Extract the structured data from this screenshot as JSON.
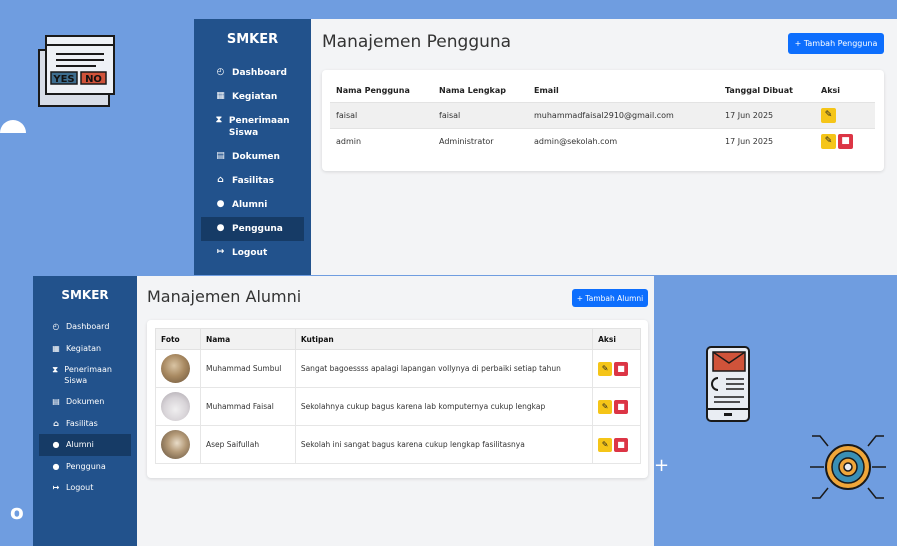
{
  "window1": {
    "brand": "SMKER",
    "nav": [
      {
        "icon": "◴",
        "label": "Dashboard"
      },
      {
        "icon": "▦",
        "label": "Kegiatan"
      },
      {
        "icon": "⧗",
        "label": "Penerimaan Siswa"
      },
      {
        "icon": "▤",
        "label": "Dokumen"
      },
      {
        "icon": "⌂",
        "label": "Fasilitas"
      },
      {
        "icon": "●",
        "label": "Alumni"
      },
      {
        "icon": "●",
        "label": "Pengguna"
      },
      {
        "icon": "↦",
        "label": "Logout"
      }
    ],
    "active_nav": "Pengguna",
    "title": "Manajemen Pengguna",
    "add_button": "+ Tambah Pengguna",
    "columns": [
      "Nama Pengguna",
      "Nama Lengkap",
      "Email",
      "Tanggal Dibuat",
      "Aksi"
    ],
    "rows": [
      {
        "username": "faisal",
        "fullname": "faisal",
        "email": "muhammadfaisal2910@gmail.com",
        "created": "17 Jun 2025",
        "can_delete": false
      },
      {
        "username": "admin",
        "fullname": "Administrator",
        "email": "admin@sekolah.com",
        "created": "17 Jun 2025",
        "can_delete": true
      }
    ]
  },
  "window2": {
    "brand": "SMKER",
    "nav": [
      {
        "icon": "◴",
        "label": "Dashboard"
      },
      {
        "icon": "▦",
        "label": "Kegiatan"
      },
      {
        "icon": "⧗",
        "label": "Penerimaan Siswa"
      },
      {
        "icon": "▤",
        "label": "Dokumen"
      },
      {
        "icon": "⌂",
        "label": "Fasilitas"
      },
      {
        "icon": "●",
        "label": "Alumni"
      },
      {
        "icon": "●",
        "label": "Pengguna"
      },
      {
        "icon": "↦",
        "label": "Logout"
      }
    ],
    "active_nav": "Alumni",
    "title": "Manajemen Alumni",
    "add_button": "+ Tambah Alumni",
    "columns": [
      "Foto",
      "Nama",
      "Kutipan",
      "Aksi"
    ],
    "rows": [
      {
        "name": "Muhammad Sumbul",
        "quote": "Sangat bagoessss apalagi lapangan vollynya di perbaiki setiap tahun"
      },
      {
        "name": "Muhammad Faisal",
        "quote": "Sekolahnya cukup bagus karena lab komputernya cukup lengkap"
      },
      {
        "name": "Asep Saifullah",
        "quote": "Sekolah ini sangat bagus karena cukup lengkap fasilitasnya"
      }
    ]
  },
  "colors": {
    "background": "#6f9de0",
    "sidebar": "#22528c",
    "active": "#163b66",
    "primary": "#0d6efd",
    "edit": "#f5c518",
    "delete": "#dc3545"
  },
  "decor": {
    "yes": "YES",
    "no": "NO",
    "plus": "+",
    "circle": "o"
  }
}
